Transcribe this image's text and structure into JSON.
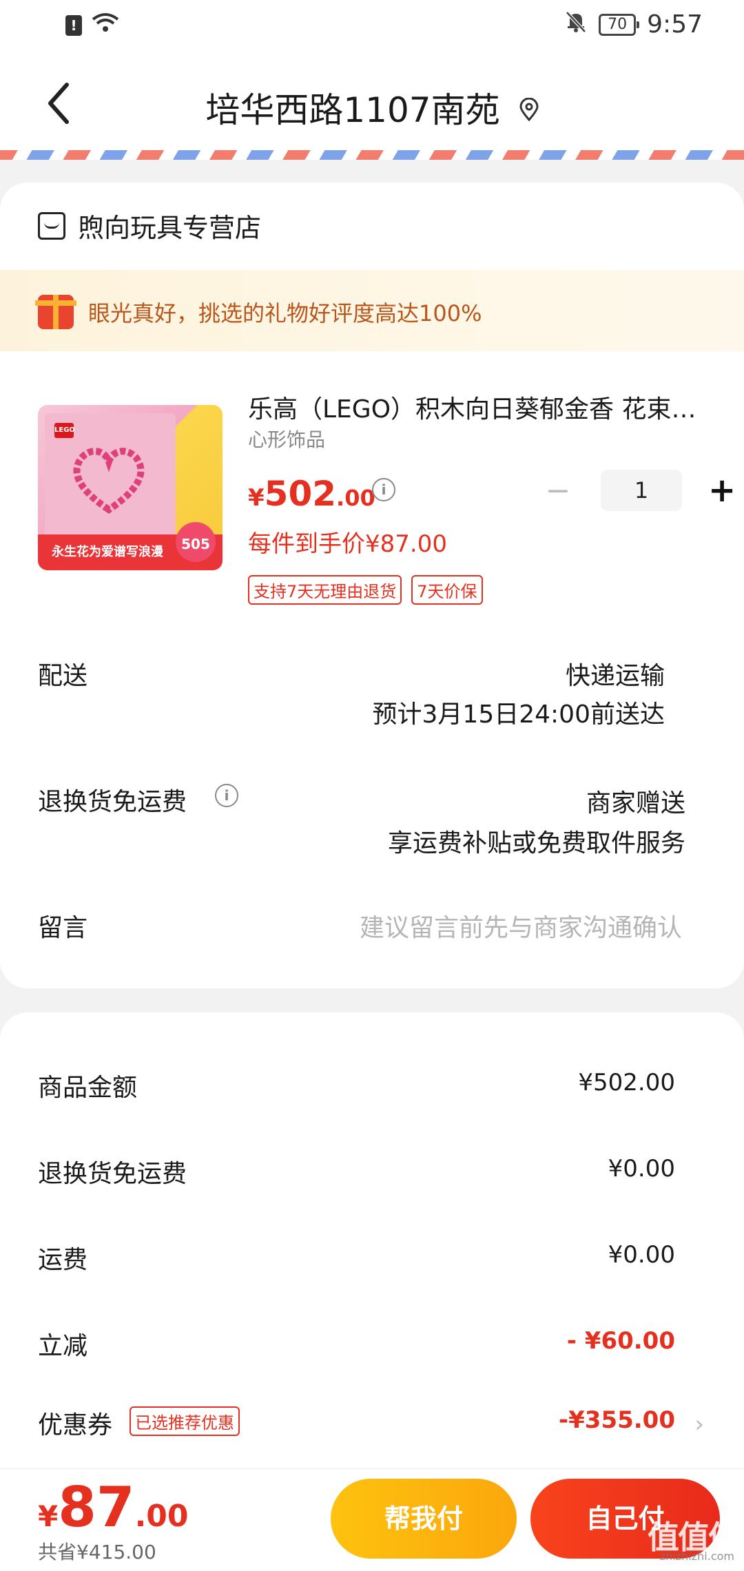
{
  "status_bar": {
    "battery": "70",
    "time": "9:57"
  },
  "header": {
    "title": "培华西路1107南苑"
  },
  "store": {
    "name": "煦向玩具专营店"
  },
  "banner": {
    "text": "眼光真好，挑选的礼物好评度高达100%"
  },
  "product": {
    "title": "乐高（LEGO）积木向日葵郁金香 花束 情人节礼物",
    "spec": "心形饰品",
    "price_currency": "¥",
    "price_int": "502",
    "price_dec": ".00",
    "quantity": "1",
    "deal_price": "每件到手价¥87.00",
    "tags": [
      "支持7天无理由退货",
      "7天价保"
    ],
    "image_banner_text": "永生花为爱谱写浪漫",
    "image_badge": "505"
  },
  "delivery": {
    "label": "配送",
    "method": "快递运输",
    "eta": "预计3月15日24:00前送达"
  },
  "return_shipping": {
    "label": "退换货免运费",
    "value": "商家赠送",
    "desc": "享运费补贴或免费取件服务"
  },
  "message": {
    "label": "留言",
    "placeholder": "建议留言前先与商家沟通确认"
  },
  "summary": {
    "items": [
      {
        "label": "商品金额",
        "value": "¥502.00"
      },
      {
        "label": "退换货免运费",
        "value": "¥0.00"
      },
      {
        "label": "运费",
        "value": "¥0.00"
      },
      {
        "label": "立减",
        "value": "- ¥60.00"
      },
      {
        "label": "优惠券",
        "value": "-¥355.00"
      }
    ],
    "coupon_tag": "已选推荐优惠"
  },
  "bottom": {
    "total_currency": "¥",
    "total_int": "87",
    "total_dec": ".00",
    "saved": "共省¥415.00",
    "help_pay": "帮我付",
    "self_pay": "自己付"
  },
  "watermark": {
    "text": "值值值",
    "sub": "zhizhizhi.com"
  },
  "colors": {
    "accent_red": "#e5301f",
    "help_yellow": "#fdb70e",
    "self_red": "#f03a1c"
  }
}
